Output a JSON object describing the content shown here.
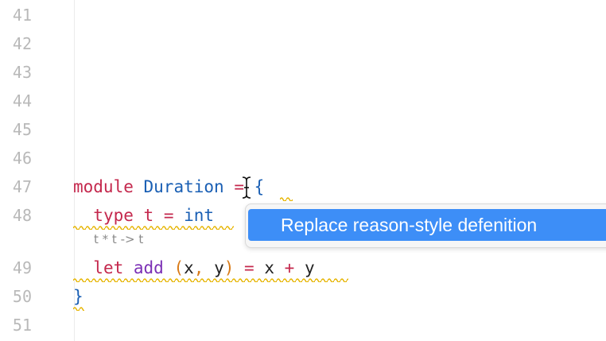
{
  "editor": {
    "line_numbers": [
      "41",
      "42",
      "43",
      "44",
      "45",
      "46",
      "47",
      "48",
      "",
      "49",
      "50",
      "51"
    ],
    "code": {
      "l47_kw": "module",
      "l47_name": "Duration",
      "l47_eq": " = ",
      "l47_brace": "{",
      "l48_kw": "type",
      "l48_name": "t",
      "l48_eq": " = ",
      "l48_type": "int",
      "hint": "t * t -> t",
      "l49_kw": "let",
      "l49_fn": "add",
      "l49_lp": "(",
      "l49_x": "x",
      "l49_comma": ",",
      "l49_y": " y",
      "l49_rp": ")",
      "l49_eq": " = ",
      "l49_x2": "x",
      "l49_plus": " + ",
      "l49_y2": "y",
      "l50_brace": "}"
    },
    "colors": {
      "keyword": "#c4284d",
      "module": "#1a5fb4",
      "function": "#7b2fb5",
      "paren": "#d97a16",
      "warning_squiggle": "#e6b400",
      "gutter": "#b9b9b9"
    }
  },
  "quick_fix": {
    "items": [
      "Replace reason-style defenition"
    ],
    "selected_color": "#3d8ef7"
  }
}
